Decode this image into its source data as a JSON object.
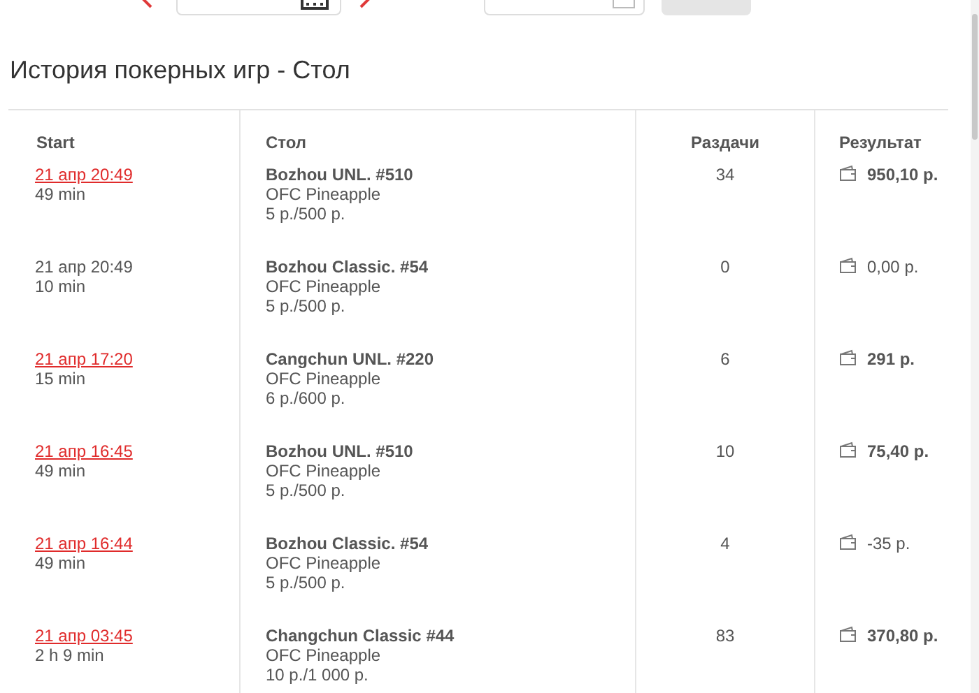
{
  "title": "История покерных игр - Стол",
  "table": {
    "columns": [
      "Start",
      "Стол",
      "Раздачи",
      "Результат"
    ],
    "rows": [
      {
        "start": "21 апр 20:49",
        "linked": true,
        "duration": "49 min",
        "table": "Bozhou UNL. #510",
        "game": "OFC Pineapple",
        "stakes": "5 р./500 р.",
        "hands": "34",
        "result": "950,10 р.",
        "bold": true
      },
      {
        "start": "21 апр 20:49",
        "linked": false,
        "duration": "10 min",
        "table": "Bozhou Classic. #54",
        "game": "OFC Pineapple",
        "stakes": "5 р./500 р.",
        "hands": "0",
        "result": "0,00 р.",
        "bold": false
      },
      {
        "start": "21 апр 17:20",
        "linked": true,
        "duration": "15 min",
        "table": "Cangchun UNL. #220",
        "game": "OFC Pineapple",
        "stakes": "6 р./600 р.",
        "hands": "6",
        "result": "291 р.",
        "bold": true
      },
      {
        "start": "21 апр 16:45",
        "linked": true,
        "duration": "49 min",
        "table": "Bozhou UNL. #510",
        "game": "OFC Pineapple",
        "stakes": "5 р./500 р.",
        "hands": "10",
        "result": "75,40 р.",
        "bold": true
      },
      {
        "start": "21 апр 16:44",
        "linked": true,
        "duration": "49 min",
        "table": "Bozhou Classic. #54",
        "game": "OFC Pineapple",
        "stakes": "5 р./500 р.",
        "hands": "4",
        "result": "-35 р.",
        "bold": false
      },
      {
        "start": "21 апр 03:45",
        "linked": true,
        "duration": "2 h 9 min",
        "table": "Changchun Classic #44",
        "game": "OFC Pineapple",
        "stakes": "10 р./1 000 р.",
        "hands": "83",
        "result": "370,80 р.",
        "bold": true
      }
    ]
  }
}
